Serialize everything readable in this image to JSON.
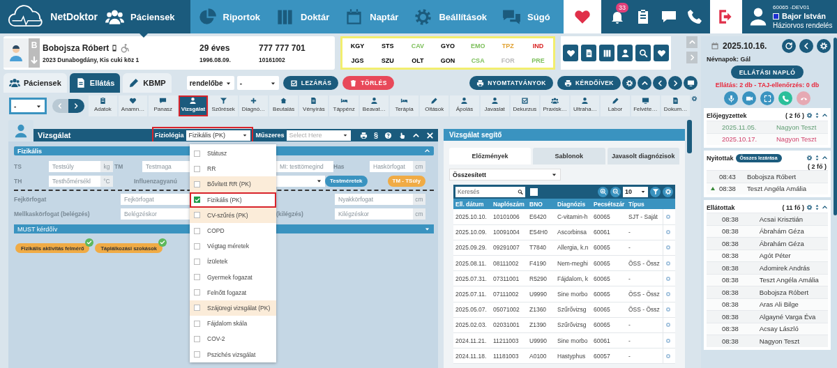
{
  "nav": {
    "brand": "NetDoktor",
    "items": [
      {
        "label": "Páciensek",
        "selected": true
      },
      {
        "label": "Riportok",
        "selected": false
      },
      {
        "label": "Doktár",
        "selected": false
      },
      {
        "label": "Naptár",
        "selected": false
      },
      {
        "label": "Beállítások",
        "selected": false
      },
      {
        "label": "Súgó",
        "selected": false
      }
    ],
    "notifications": "33",
    "user": {
      "code": "60065 -DEV01",
      "name": "Bajor István",
      "role": "Háziorvos rendelés"
    }
  },
  "patient": {
    "initial": "B",
    "name": "Bobojsza Róbert",
    "address": "2023 Dunabogdány, Kis cuki köz 1",
    "age": "29 éves",
    "birth": "1996.08.09.",
    "phone": "777 777 701",
    "number": "10161002"
  },
  "codes": [
    {
      "label": "KGY",
      "color": "#000000"
    },
    {
      "label": "STS",
      "color": "#000000"
    },
    {
      "label": "CAV",
      "color": "#7cbf5a"
    },
    {
      "label": "GYO",
      "color": "#000000"
    },
    {
      "label": "EMO",
      "color": "#7cbf5a"
    },
    {
      "label": "TPZ",
      "color": "#e0a030"
    },
    {
      "label": "IND",
      "color": "#d82020"
    },
    {
      "label": "JGS",
      "color": "#000000"
    },
    {
      "label": "SZU",
      "color": "#000000"
    },
    {
      "label": "OLT",
      "color": "#000000"
    },
    {
      "label": "GON",
      "color": "#000000"
    },
    {
      "label": "CSA",
      "color": "#7cbf5a"
    },
    {
      "label": "FOR",
      "color": "#b8b8b8"
    },
    {
      "label": "PRE",
      "color": "#7cbf5a"
    }
  ],
  "tabs": [
    {
      "label": "Páciensek",
      "selected": false
    },
    {
      "label": "Ellátás",
      "selected": true
    },
    {
      "label": "KBMP",
      "selected": false
    }
  ],
  "selects": [
    "rendelőbe",
    "-"
  ],
  "actions": [
    {
      "label": "LEZÁRÁS",
      "kind": "primary"
    },
    {
      "label": "TÖRLÉS",
      "kind": "danger"
    }
  ],
  "print_buttons": [
    "NYOMTATVÁNYOK",
    "KÉRDŐÍVEK"
  ],
  "toolbar": {
    "select": "-",
    "tools": [
      {
        "label": "Adatok",
        "selected": false,
        "outlined": false
      },
      {
        "label": "Anamn…",
        "selected": false,
        "outlined": false
      },
      {
        "label": "Panasz",
        "selected": false,
        "outlined": false
      },
      {
        "label": "Vizsgálat",
        "selected": true,
        "outlined": true
      },
      {
        "label": "Szűrések",
        "selected": false,
        "outlined": false
      },
      {
        "label": "Diagnó…",
        "selected": false,
        "outlined": false
      },
      {
        "label": "Beutalás",
        "selected": false,
        "outlined": false
      },
      {
        "label": "Vényírás",
        "selected": false,
        "outlined": false
      },
      {
        "label": "Táppénz",
        "selected": false,
        "outlined": false
      },
      {
        "label": "Beavat…",
        "selected": false,
        "outlined": false
      },
      {
        "label": "Terápia",
        "selected": false,
        "outlined": false
      },
      {
        "label": "Oltások",
        "selected": false,
        "outlined": false
      },
      {
        "label": "Ápolás",
        "selected": false,
        "outlined": false
      },
      {
        "label": "Javaslat",
        "selected": false,
        "outlined": false
      },
      {
        "label": "Dekurzus",
        "selected": false,
        "outlined": false
      },
      {
        "label": "Praxisk…",
        "selected": false,
        "outlined": false
      },
      {
        "label": "Ultraha…",
        "selected": false,
        "outlined": false
      },
      {
        "label": "Labor",
        "selected": false,
        "outlined": false
      },
      {
        "label": "Felvéte…",
        "selected": false,
        "outlined": false
      },
      {
        "label": "Dokum…",
        "selected": false,
        "outlined": false
      }
    ]
  },
  "exam": {
    "title": "Vizsgálat",
    "fiziologia": {
      "label": "Fiziológia",
      "value": "Fizikális (PK)",
      "outlined": true
    },
    "muszeres": {
      "label": "Műszeres",
      "placeholder": "Select Here"
    },
    "section_sign": "§",
    "section": "Fizikális",
    "rows": [
      {
        "divider_below": false,
        "left": [
          {
            "kind": "label",
            "text": "TS"
          },
          {
            "kind": "field",
            "placeholder": "Testsúly",
            "unit": "kg"
          },
          {
            "kind": "label",
            "text": "TM"
          },
          {
            "kind": "field",
            "placeholder": "Testmaga"
          }
        ],
        "right": [
          {
            "kind": "field",
            "placeholder": "MI: testtömegind"
          },
          {
            "kind": "label",
            "text": "Has"
          },
          {
            "kind": "field",
            "placeholder": "Haskörfogat",
            "unit": "cm"
          }
        ]
      },
      {
        "divider_below": true,
        "left": [
          {
            "kind": "label",
            "text": "TH"
          },
          {
            "kind": "field",
            "placeholder": "Testhőmérsékl",
            "unit": "°C"
          },
          {
            "kind": "label",
            "text": "Influenzagyanú"
          }
        ],
        "right": [
          {
            "kind": "select"
          },
          {
            "kind": "button",
            "text": "Testméretek",
            "color": "#3a93c0"
          },
          {
            "kind": "button",
            "text": "TM - TSúly",
            "color": "#f0ab45"
          }
        ]
      },
      {
        "divider_below": false,
        "left": [
          {
            "kind": "label",
            "text": "Fejkörfogat"
          },
          {
            "kind": "field",
            "placeholder": "Fejkörfogat"
          }
        ],
        "right": [
          {
            "kind": "field",
            "placeholder": "Nyakkörfogat",
            "unit": "cm"
          }
        ]
      },
      {
        "divider_below": false,
        "left": [
          {
            "kind": "label",
            "text": "Mellkaskörfogat (belégzés)"
          },
          {
            "kind": "field",
            "placeholder": "Belégzéskor"
          }
        ],
        "right": [
          {
            "kind": "label",
            "text": "(kilégzés)"
          },
          {
            "kind": "field",
            "placeholder": "Kilégzéskor",
            "unit": "cm"
          }
        ]
      }
    ],
    "questionnaire": "MUST kérdőív",
    "chips": [
      {
        "label": "Fizikális aktivitás felmérő",
        "done": true
      },
      {
        "label": "Táplálkozási szokások",
        "done": true
      }
    ],
    "dropdown": [
      {
        "label": "Státusz",
        "checked": false,
        "tinted": false,
        "outlined": false
      },
      {
        "label": "RR",
        "checked": false,
        "tinted": false,
        "outlined": false
      },
      {
        "label": "Bővített RR (PK)",
        "checked": false,
        "tinted": true,
        "outlined": false
      },
      {
        "label": "Fizikális (PK)",
        "checked": true,
        "tinted": false,
        "outlined": true
      },
      {
        "label": "CV-szűrés (PK)",
        "checked": false,
        "tinted": true,
        "outlined": false
      },
      {
        "label": "COPD",
        "checked": false,
        "tinted": false,
        "outlined": false
      },
      {
        "label": "Végtag méretek",
        "checked": false,
        "tinted": false,
        "outlined": false
      },
      {
        "label": "Ízületek",
        "checked": false,
        "tinted": false,
        "outlined": false
      },
      {
        "label": "Gyermek fogazat",
        "checked": false,
        "tinted": false,
        "outlined": false
      },
      {
        "label": "Felnőtt fogazat",
        "checked": false,
        "tinted": false,
        "outlined": false
      },
      {
        "label": "Szájüregi vizsgálat (PK)",
        "checked": false,
        "tinted": true,
        "outlined": false
      },
      {
        "label": "Fájdalom skála",
        "checked": false,
        "tinted": false,
        "outlined": false
      },
      {
        "label": "COV-2",
        "checked": false,
        "tinted": false,
        "outlined": false
      },
      {
        "label": "Pszichés vizsgálat",
        "checked": false,
        "tinted": false,
        "outlined": false
      }
    ]
  },
  "helper": {
    "title": "Vizsgálat segítő",
    "tabs": [
      {
        "label": "Előzmények",
        "selected": true
      },
      {
        "label": "Sablonok",
        "selected": false
      },
      {
        "label": "Javasolt diagnózisok",
        "selected": false
      }
    ],
    "filter": "Összesített",
    "search_placeholder": "Keresés",
    "select_all_checked": false,
    "page_size": "10",
    "columns": [
      "Ell. dátum",
      "Naplószám",
      "BNO",
      "Diagnózis",
      "Pecsétszár",
      "Típus"
    ],
    "rows": [
      [
        "2025.10.10.",
        "10101006",
        "E6420",
        "C-vitamin-h",
        "60065",
        "SJT - Saját"
      ],
      [
        "2025.10.09.",
        "10091004",
        "E54H0",
        "Ascorbinsa",
        "60061",
        "-"
      ],
      [
        "2025.09.29.",
        "09291007",
        "T7840",
        "Allergia, k.n",
        "60065",
        "-"
      ],
      [
        "2025.08.11.",
        "08111002",
        "F4190",
        "Nem-meghi",
        "60065",
        "ÖSS - Össz"
      ],
      [
        "2025.07.31.",
        "07311001",
        "R5290",
        "Fájdalom, k",
        "60065",
        "-"
      ],
      [
        "2025.07.11.",
        "07111002",
        "U9990",
        "Sine morbo",
        "60065",
        "ÖSS - Össz"
      ],
      [
        "2025.05.07.",
        "05071002",
        "Z1360",
        "Szűrővizsg",
        "60065",
        "ÖSS - Össz"
      ],
      [
        "2025.02.03.",
        "02031001",
        "Z1390",
        "Szűrővizsg",
        "60065",
        "-"
      ],
      [
        "2024.11.21.",
        "11211003",
        "U9990",
        "Sine morbo",
        "60061",
        "-"
      ],
      [
        "2024.11.18.",
        "11181003",
        "A0100",
        "Hastyphus",
        "60057",
        "-"
      ]
    ]
  },
  "sidebar": {
    "date": "2025.10.16.",
    "nameday": "Névnapok: Gál",
    "log_button": "ELLÁTÁSI NAPLÓ",
    "status": "Ellátás: 2 db - TAJ-ellenőrzés: 0 db",
    "scheduled": {
      "title": "Előjegyzettek",
      "count": "( 2 fő )",
      "rows": [
        {
          "date": "2025.11.05.",
          "name": "Nagyon Teszt",
          "color": "#5f9c72"
        },
        {
          "date": "2025.10.17.",
          "name": "Nagyon Teszt",
          "color": "#d0406a"
        }
      ]
    },
    "open": {
      "title": "Nyitottak",
      "action": "Összes lezárása",
      "count": "( 2 fő )",
      "rows": [
        {
          "time": "08:43",
          "name": "Bobojsza Róbert",
          "flagged": false
        },
        {
          "time": "08:38",
          "name": "Teszt Angéla Amália",
          "flagged": true
        }
      ]
    },
    "done": {
      "title": "Ellátottak",
      "count": "( 11 fő )",
      "rows": [
        {
          "time": "08:38",
          "name": "Acsai Krisztián"
        },
        {
          "time": "08:38",
          "name": "Ábrahám Géza"
        },
        {
          "time": "08:38",
          "name": "Ábrahám Géza"
        },
        {
          "time": "08:38",
          "name": "Agót Péter"
        },
        {
          "time": "08:38",
          "name": "Adomirek András"
        },
        {
          "time": "08:38",
          "name": "Teszt Angéla Amália"
        },
        {
          "time": "08:38",
          "name": "Bobojsza Róbert"
        },
        {
          "time": "08:38",
          "name": "Aras Ali Bilge"
        },
        {
          "time": "08:38",
          "name": "Algayné Varga Éva"
        },
        {
          "time": "08:38",
          "name": "Acsay László"
        },
        {
          "time": "08:38",
          "name": "Nagyon Teszt"
        }
      ]
    }
  }
}
